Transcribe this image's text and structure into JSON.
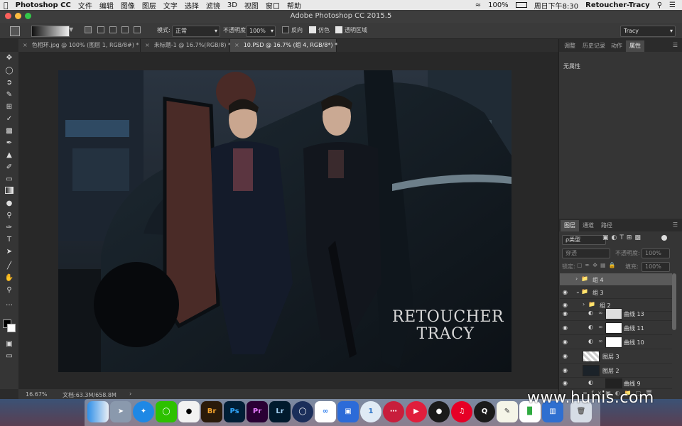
{
  "menubar": {
    "apple": "",
    "app_name": "Photoshop CC",
    "items": [
      "文件",
      "编辑",
      "图像",
      "图层",
      "文字",
      "选择",
      "滤镜",
      "3D",
      "视图",
      "窗口",
      "帮助"
    ],
    "battery": "100%",
    "clock": "周日下午8:30",
    "user": "Retoucher-Tracy"
  },
  "window": {
    "title": "Adobe Photoshop CC 2015.5"
  },
  "options": {
    "mode_label": "模式:",
    "mode_value": "正常",
    "opacity_label": "不透明度:",
    "opacity_value": "100%",
    "reverse_label": "反向",
    "dither_label": "仿色",
    "transparency_label": "透明区域",
    "workspace": "Tracy"
  },
  "tabs": [
    {
      "label": "色相环.jpg @ 100% (图层 1, RGB/8#) *"
    },
    {
      "label": "未标题-1 @ 16.7%(RGB/8) *"
    },
    {
      "label": "10.PSD @ 16.7% (组 4, RGB/8*) *"
    }
  ],
  "status": {
    "zoom": "16.67%",
    "doc": "文档:63.3M/658.8M",
    "arrow": "›"
  },
  "photo": {
    "line1": "RETOUCHER",
    "line2": "TRACY"
  },
  "properties_panel": {
    "tabs": [
      "调整",
      "历史记录",
      "动作",
      "属性"
    ],
    "active_tab": "属性",
    "content": "无属性"
  },
  "layers_panel": {
    "tabs": [
      "图层",
      "通道",
      "路径"
    ],
    "active_tab": "图层",
    "filter_label": "ρ类型",
    "blend_mode": "穿透",
    "opacity_label": "不透明度:",
    "opacity_value": "100%",
    "lock_label": "锁定:",
    "fill_label": "填充:",
    "fill_value": "100%",
    "layers": [
      {
        "name": "组 4",
        "type": "group",
        "selected": true,
        "visible": false
      },
      {
        "name": "组 3",
        "type": "group-open",
        "selected": false,
        "visible": true
      },
      {
        "name": "组 2",
        "type": "group",
        "selected": false,
        "visible": true
      },
      {
        "name": "曲线 13",
        "type": "adjust",
        "selected": false,
        "visible": true
      },
      {
        "name": "曲线 11",
        "type": "adjust",
        "selected": false,
        "visible": true
      },
      {
        "name": "曲线 10",
        "type": "adjust",
        "selected": false,
        "visible": true
      },
      {
        "name": "图层 3",
        "type": "pixel",
        "selected": false,
        "visible": true
      },
      {
        "name": "图层 2",
        "type": "pixel",
        "selected": false,
        "visible": true
      },
      {
        "name": "曲线 9",
        "type": "adjust",
        "selected": false,
        "visible": true
      }
    ]
  },
  "dock": {
    "apps": [
      "Finder",
      "Launchpad",
      "Safari",
      "WeChat",
      "QQ",
      "Br",
      "Ps",
      "Pr",
      "Lr",
      "Cinema 4D",
      "Baidu",
      "Video",
      "1Password",
      "DaVinci",
      "Media",
      "OBS",
      "NetEase",
      "QuickTime",
      "TextEdit",
      "Numbers",
      "Keynote",
      "Trash"
    ]
  },
  "watermark": "www.hunis.com"
}
